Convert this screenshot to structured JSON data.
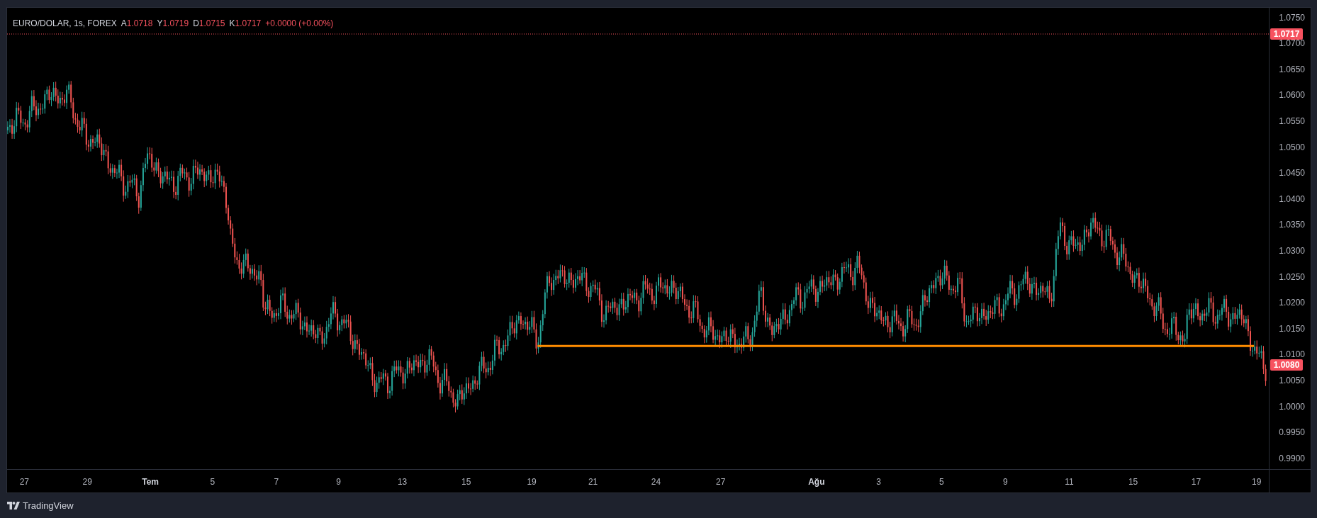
{
  "legend": {
    "symbol": "EURO/DOLAR, 1s, FOREX",
    "ohlc": [
      {
        "label": "A",
        "value": "1.0718"
      },
      {
        "label": "Y",
        "value": "1.0719"
      },
      {
        "label": "D",
        "value": "1.0715"
      },
      {
        "label": "K",
        "value": "1.0717"
      }
    ],
    "change": "+0.0000 (+0.00%)"
  },
  "price_axis": {
    "ticks": [
      "1.0750",
      "1.0700",
      "1.0650",
      "1.0600",
      "1.0550",
      "1.0500",
      "1.0450",
      "1.0400",
      "1.0350",
      "1.0300",
      "1.0250",
      "1.0200",
      "1.0150",
      "1.0100",
      "1.0050",
      "1.0000",
      "0.9950",
      "0.9900"
    ],
    "price_labels": [
      {
        "kind": "previous",
        "value": "1.0717"
      },
      {
        "kind": "last",
        "value": "1.0080"
      }
    ]
  },
  "time_axis": {
    "labels": [
      {
        "text": "27",
        "kind": "day"
      },
      {
        "text": "29",
        "kind": "day"
      },
      {
        "text": "Tem",
        "kind": "month"
      },
      {
        "text": "5",
        "kind": "day"
      },
      {
        "text": "7",
        "kind": "day"
      },
      {
        "text": "9",
        "kind": "day"
      },
      {
        "text": "13",
        "kind": "day"
      },
      {
        "text": "15",
        "kind": "day"
      },
      {
        "text": "19",
        "kind": "day"
      },
      {
        "text": "21",
        "kind": "day"
      },
      {
        "text": "24",
        "kind": "day"
      },
      {
        "text": "27",
        "kind": "day"
      },
      {
        "text": "Ağu",
        "kind": "month"
      },
      {
        "text": "3",
        "kind": "day"
      },
      {
        "text": "5",
        "kind": "day"
      },
      {
        "text": "9",
        "kind": "day"
      },
      {
        "text": "11",
        "kind": "day"
      },
      {
        "text": "15",
        "kind": "day"
      },
      {
        "text": "17",
        "kind": "day"
      },
      {
        "text": "19",
        "kind": "day"
      }
    ]
  },
  "footer": {
    "logo": "TradingView"
  }
}
